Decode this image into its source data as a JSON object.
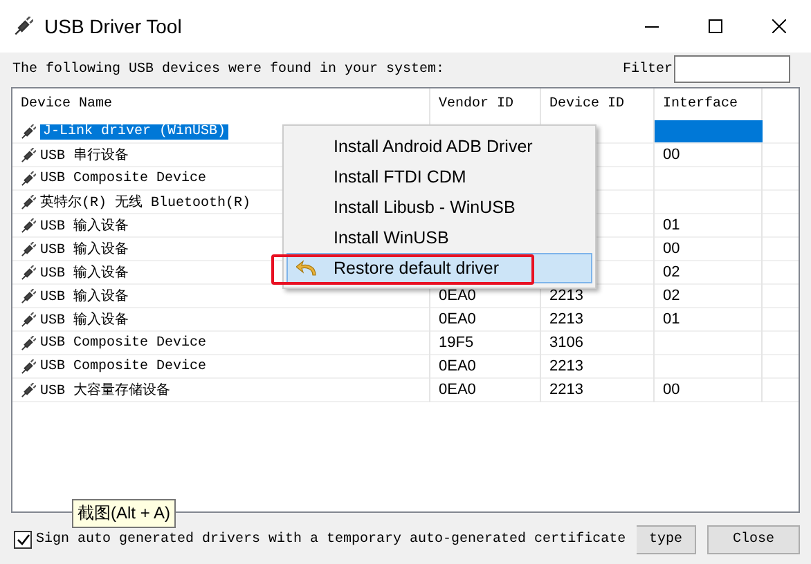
{
  "window": {
    "title": "USB Driver Tool"
  },
  "intro": "The following USB devices were found in your system:",
  "filter": {
    "label": "Filter"
  },
  "table": {
    "columns": [
      "Device Name",
      "Vendor ID",
      "Device ID",
      "Interface"
    ],
    "rows": [
      {
        "name": "J-Link driver (WinUSB)",
        "vendor": "",
        "device": "",
        "interface": "",
        "selected": true
      },
      {
        "name": "USB 串行设备",
        "vendor": "",
        "device": "",
        "interface": "00",
        "selected": false
      },
      {
        "name": "USB Composite Device",
        "vendor": "",
        "device": "",
        "interface": "",
        "selected": false
      },
      {
        "name": "英特尔(R) 无线 Bluetooth(R)",
        "vendor": "",
        "device": "",
        "interface": "",
        "selected": false
      },
      {
        "name": "USB 输入设备",
        "vendor": "",
        "device": "",
        "interface": "01",
        "selected": false
      },
      {
        "name": "USB 输入设备",
        "vendor": "",
        "device": "",
        "interface": "00",
        "selected": false
      },
      {
        "name": "USB 输入设备",
        "vendor": "",
        "device": "",
        "interface": "02",
        "selected": false
      },
      {
        "name": "USB 输入设备",
        "vendor": "0EA0",
        "device": "2213",
        "interface": "02",
        "selected": false
      },
      {
        "name": "USB 输入设备",
        "vendor": "0EA0",
        "device": "2213",
        "interface": "01",
        "selected": false
      },
      {
        "name": "USB Composite Device",
        "vendor": "19F5",
        "device": "3106",
        "interface": "",
        "selected": false
      },
      {
        "name": "USB Composite Device",
        "vendor": "0EA0",
        "device": "2213",
        "interface": "",
        "selected": false
      },
      {
        "name": "USB 大容量存储设备",
        "vendor": "0EA0",
        "device": "2213",
        "interface": "00",
        "selected": false
      }
    ]
  },
  "context_menu": {
    "items": [
      {
        "label": "Install Android ADB Driver",
        "selected": false,
        "icon": false
      },
      {
        "label": "Install FTDI CDM",
        "selected": false,
        "icon": false
      },
      {
        "label": "Install Libusb - WinUSB",
        "selected": false,
        "icon": false
      },
      {
        "label": "Install WinUSB",
        "selected": false,
        "icon": false
      },
      {
        "label": "Restore default driver",
        "selected": true,
        "icon": true
      }
    ]
  },
  "sign_checkbox": {
    "label": "Sign auto generated drivers with a temporary auto-generated certificate",
    "checked": true
  },
  "buttons": [
    "type",
    "Close"
  ],
  "tooltip": "截图(Alt + A)"
}
